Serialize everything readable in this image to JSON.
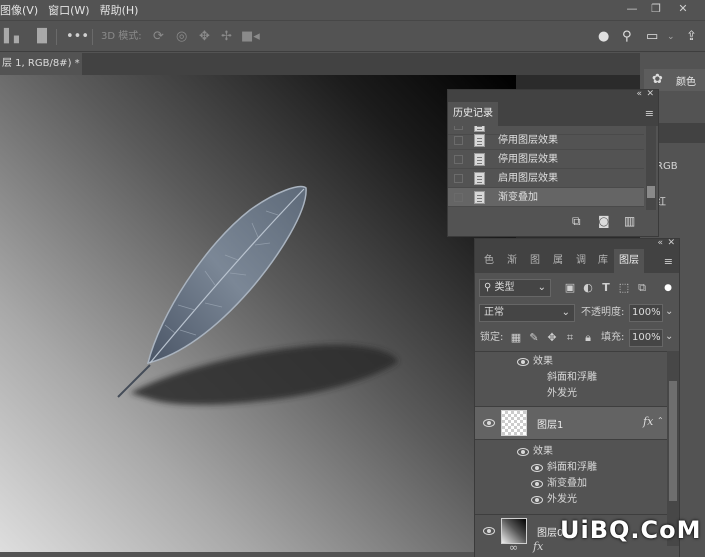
{
  "menu": [
    "图像(V)",
    "窗口(W)",
    "帮助(H)"
  ],
  "options_bar": {
    "mode_3d_label": "3D 模式:"
  },
  "document": {
    "tab_title": "层 1, RGB/8#) *",
    "close_glyph": "×"
  },
  "color_panel": {
    "title": "颜色",
    "partial_labels": [
      "RGB",
      "红"
    ]
  },
  "history_panel": {
    "title": "历史记录",
    "items": [
      "停用图层效果",
      "停用图层效果",
      "启用图层效果",
      "渐变叠加"
    ],
    "selected_index": 3
  },
  "layers_panel": {
    "tabs": [
      "色",
      "渐",
      "图",
      "属",
      "调",
      "库",
      "图层"
    ],
    "active_tab_index": 6,
    "filter_label": "类型",
    "blend_mode": "正常",
    "opacity_label": "不透明度:",
    "opacity_value": "100%",
    "lock_label": "锁定:",
    "fill_label": "填充:",
    "fill_value": "100%",
    "top_effects": {
      "header": "效果",
      "items": [
        "斜面和浮雕",
        "外发光"
      ]
    },
    "layers": [
      {
        "name": "图层1",
        "fx": "fx",
        "effects_header": "效果",
        "effects": [
          "斜面和浮雕",
          "渐变叠加",
          "外发光"
        ]
      },
      {
        "name": "图层0"
      }
    ],
    "bottom_fx": "fx"
  },
  "watermark": "UiBQ.CoM",
  "colors": {
    "app_bg": "#535353",
    "panel_dark": "#424242",
    "canvas_outer": "#2b2b2b",
    "history_selected": "#656565",
    "accent_white": "#ffffff"
  }
}
